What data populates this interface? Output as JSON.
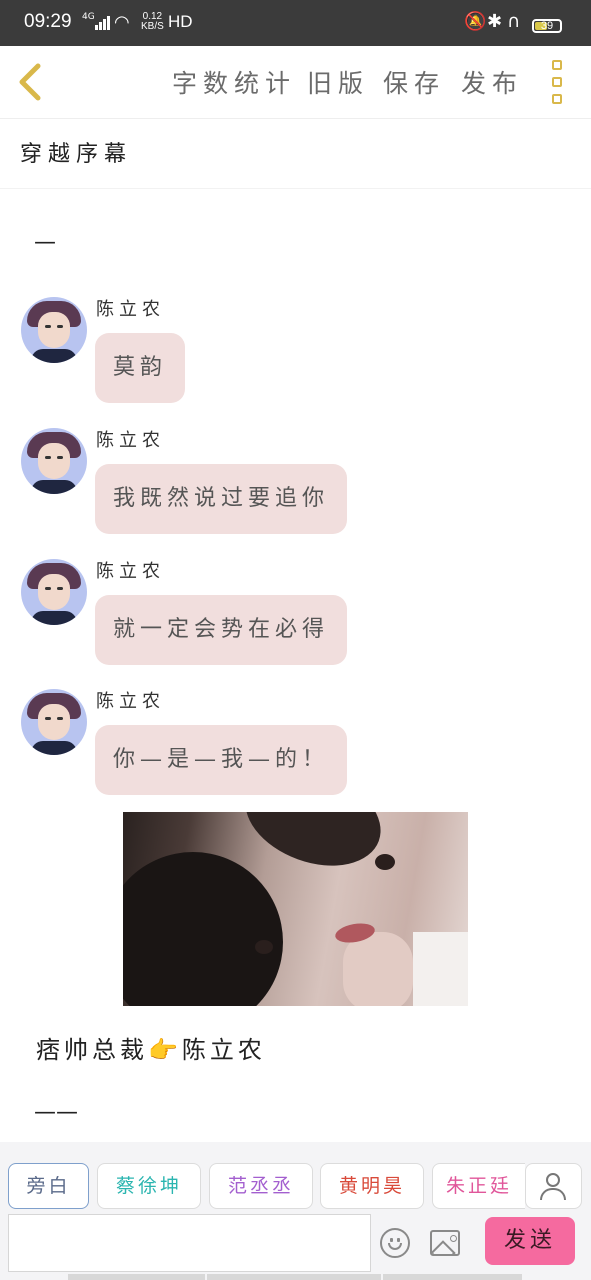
{
  "status_bar": {
    "time": "09:29",
    "network": "4G",
    "speed_value": "0.12",
    "speed_unit": "KB/S",
    "hd": "HD",
    "battery": "39",
    "icons": [
      "signal-icon",
      "wifi-icon",
      "mute-icon",
      "bluetooth-icon",
      "headphones-icon",
      "battery-icon"
    ]
  },
  "toolbar": {
    "back_icon": "chevron-left-icon",
    "items": [
      "字数统计",
      "旧版",
      "保存",
      "发布"
    ],
    "more_icon": "more-vertical-icon"
  },
  "chapter": {
    "title": "穿越序幕",
    "opening_mark": "—",
    "closing_mark": "——"
  },
  "messages": [
    {
      "name": "陈立农",
      "text": "莫韵"
    },
    {
      "name": "陈立农",
      "text": "我既然说过要追你"
    },
    {
      "name": "陈立农",
      "text": "就一定会势在必得"
    },
    {
      "name": "陈立农",
      "text": "你—是—我—的！"
    }
  ],
  "caption": "痞帅总裁👉陈立农",
  "roles": {
    "items": [
      {
        "label": "旁白",
        "color": "#5a6a8a"
      },
      {
        "label": "蔡徐坤",
        "color": "#2bb5b0"
      },
      {
        "label": "范丞丞",
        "color": "#a35fcf"
      },
      {
        "label": "黄明昊",
        "color": "#d94a3a"
      },
      {
        "label": "朱正廷",
        "color": "#e0569a"
      }
    ],
    "selected": "旁白"
  },
  "input": {
    "value": "",
    "send_label": "发送",
    "send_color": "#f56a9f"
  }
}
